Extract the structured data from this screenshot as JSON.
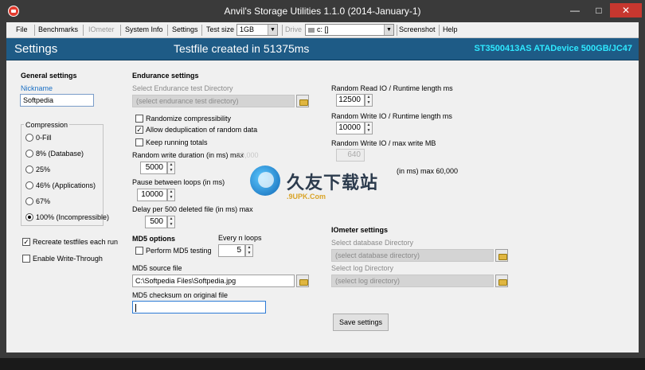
{
  "window": {
    "title": "Anvil's Storage Utilities 1.1.0 (2014-January-1)",
    "min_glyph": "—",
    "max_glyph": "□",
    "close_glyph": "✕"
  },
  "menu": {
    "file": "File",
    "benchmarks": "Benchmarks",
    "iometer": "IOmeter",
    "system_info": "System Info",
    "settings": "Settings",
    "test_size_label": "Test size",
    "test_size_value": "1GB",
    "drive_label": "Drive",
    "drive_value": "c: []",
    "screenshot": "Screenshot",
    "help": "Help"
  },
  "header": {
    "title": "Settings",
    "status": "Testfile created in 51375ms",
    "device": "ST3500413AS ATADevice 500GB/JC47"
  },
  "general": {
    "title": "General settings",
    "nickname_label": "Nickname",
    "nickname_value": "Softpedia",
    "compression_label": "Compression",
    "compression_options": [
      "0-Fill",
      "8% (Database)",
      "25%",
      "46% (Applications)",
      "67%",
      "100% (Incompressible)"
    ],
    "compression_selected": 5,
    "recreate_label": "Recreate testfiles each run",
    "recreate_checked": true,
    "write_through_label": "Enable Write-Through",
    "write_through_checked": false
  },
  "endurance": {
    "title": "Endurance settings",
    "dir_label": "Select Endurance test Directory",
    "dir_placeholder": "(select endurance test directory)",
    "randomize_label": "Randomize compressibility",
    "randomize_checked": false,
    "dedup_label": "Allow deduplication of random data",
    "dedup_checked": true,
    "running_totals_label": "Keep running totals",
    "running_totals_checked": false,
    "write_duration_label": "Random write duration (in ms) max",
    "write_duration_max": "30,000",
    "write_duration_value": "5000",
    "pause_label": "Pause between loops (in ms)",
    "pause_value": "10000",
    "delay_label": "Delay per 500 deleted file (in ms) max",
    "delay_value": "500"
  },
  "md5": {
    "title": "MD5 options",
    "every_n_label": "Every n loops",
    "every_n_value": "5",
    "perform_label": "Perform MD5 testing",
    "perform_checked": false,
    "source_label": "MD5 source file",
    "source_value": "C:\\Softpedia Files\\Softpedia.jpg",
    "checksum_label": "MD5 checksum on original file",
    "checksum_value": ""
  },
  "random_io": {
    "read_label": "Random Read IO / Runtime length ms",
    "read_value": "12500",
    "write_label": "Random Write IO / Runtime length ms",
    "write_value": "10000",
    "max_write_label": "Random Write IO / max write MB",
    "max_write_value": "640",
    "extra_label": "(in ms) max 60,000"
  },
  "iometer": {
    "title": "IOmeter settings",
    "db_dir_label": "Select database Directory",
    "db_dir_placeholder": "(select database directory)",
    "log_dir_label": "Select log Directory",
    "log_dir_placeholder": "(select log directory)",
    "save_label": "Save settings"
  },
  "watermark": {
    "text": "久友下载站",
    "url": ".9UPK.Com"
  }
}
